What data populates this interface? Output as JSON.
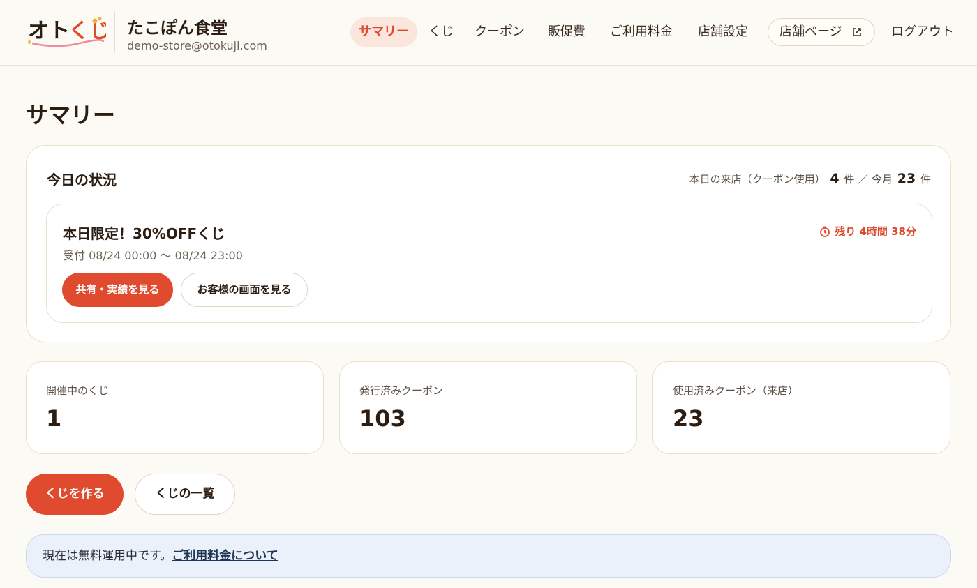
{
  "header": {
    "logo_text": "オトくじ",
    "store_name": "たこぽん食堂",
    "store_email": "demo-store@otokuji.com",
    "nav": {
      "summary": "サマリー",
      "kuji": "くじ",
      "coupon": "クーポン",
      "promo": "販促費",
      "fees": "ご利用料金",
      "settings": "店舗設定",
      "store_page": "店舗ページ",
      "logout": "ログアウト"
    },
    "active_nav": "summary"
  },
  "page": {
    "title": "サマリー"
  },
  "today": {
    "title": "今日の状況",
    "stats_prefix": "本日の来店（クーポン使用）",
    "today_count": "4",
    "count_unit": "件",
    "separator": "／ 今月",
    "month_count": "23",
    "lottery": {
      "name": "本日限定！30%OFFくじ",
      "period": "受付 08/24 00:00 〜 08/24 23:00",
      "remaining": "残り 4時間 38分",
      "share_button": "共有・実績を見る",
      "customer_view_button": "お客様の画面を見る"
    }
  },
  "stats": [
    {
      "label": "開催中のくじ",
      "value": "1"
    },
    {
      "label": "発行済みクーポン",
      "value": "103"
    },
    {
      "label": "使用済みクーポン（来店）",
      "value": "23"
    }
  ],
  "actions": {
    "create": "くじを作る",
    "list": "くじの一覧"
  },
  "notice": {
    "text": "現在は無料運用中です。",
    "link": "ご利用料金について"
  },
  "colors": {
    "accent": "#e04a2e",
    "background": "#fcfaf5",
    "notice_bg": "#ebf1fa"
  },
  "icons": {
    "external_link": "external-link-icon",
    "clock": "clock-icon"
  }
}
